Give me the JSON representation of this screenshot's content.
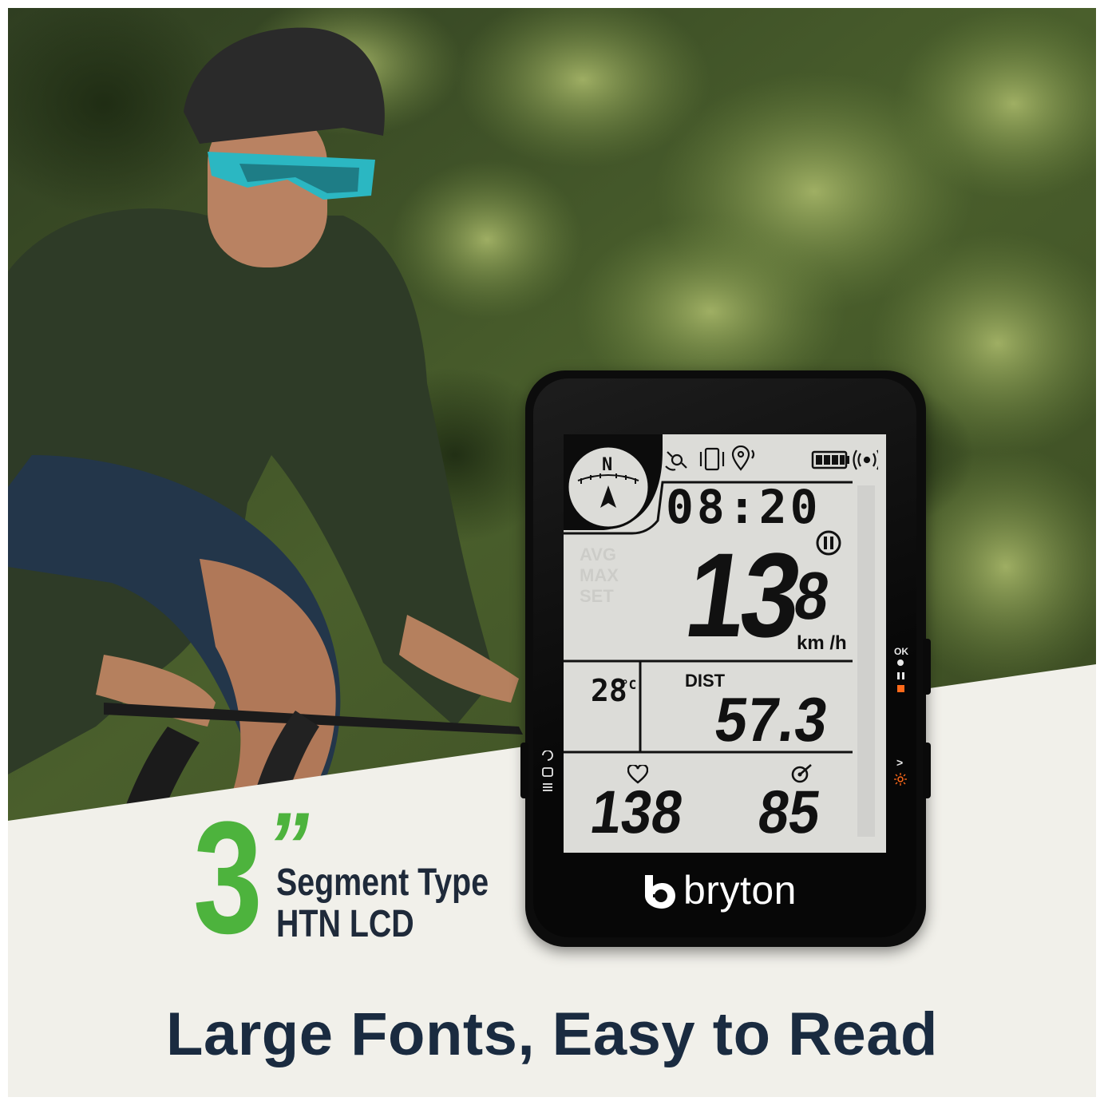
{
  "headline": {
    "size_number": "3",
    "size_unit": "”",
    "spec_line1": "Segment Type",
    "spec_line2": "HTN LCD"
  },
  "tagline": "Large Fonts, Easy to Read",
  "device": {
    "brand": "bryton",
    "compass_heading": "N",
    "time": "08:20",
    "speed_main": "13",
    "speed_decimal": "8",
    "speed_unit": "km /h",
    "temperature": "28",
    "temperature_unit": "°C",
    "distance_label": "DIST",
    "distance_value": "57.3",
    "heart_rate": "138",
    "cadence": "85",
    "ghost_labels": [
      "AVG",
      "MAX",
      "SET"
    ],
    "button_labels": {
      "ok": "OK",
      "next": ">"
    }
  },
  "colors": {
    "accent_green": "#4db33d",
    "heading_navy": "#1a2b40",
    "panel_cream": "#f1f0ea",
    "lcd_background": "#dcdcd8",
    "device_body": "#0c0c0c",
    "indicator_orange": "#ff6a1a"
  }
}
